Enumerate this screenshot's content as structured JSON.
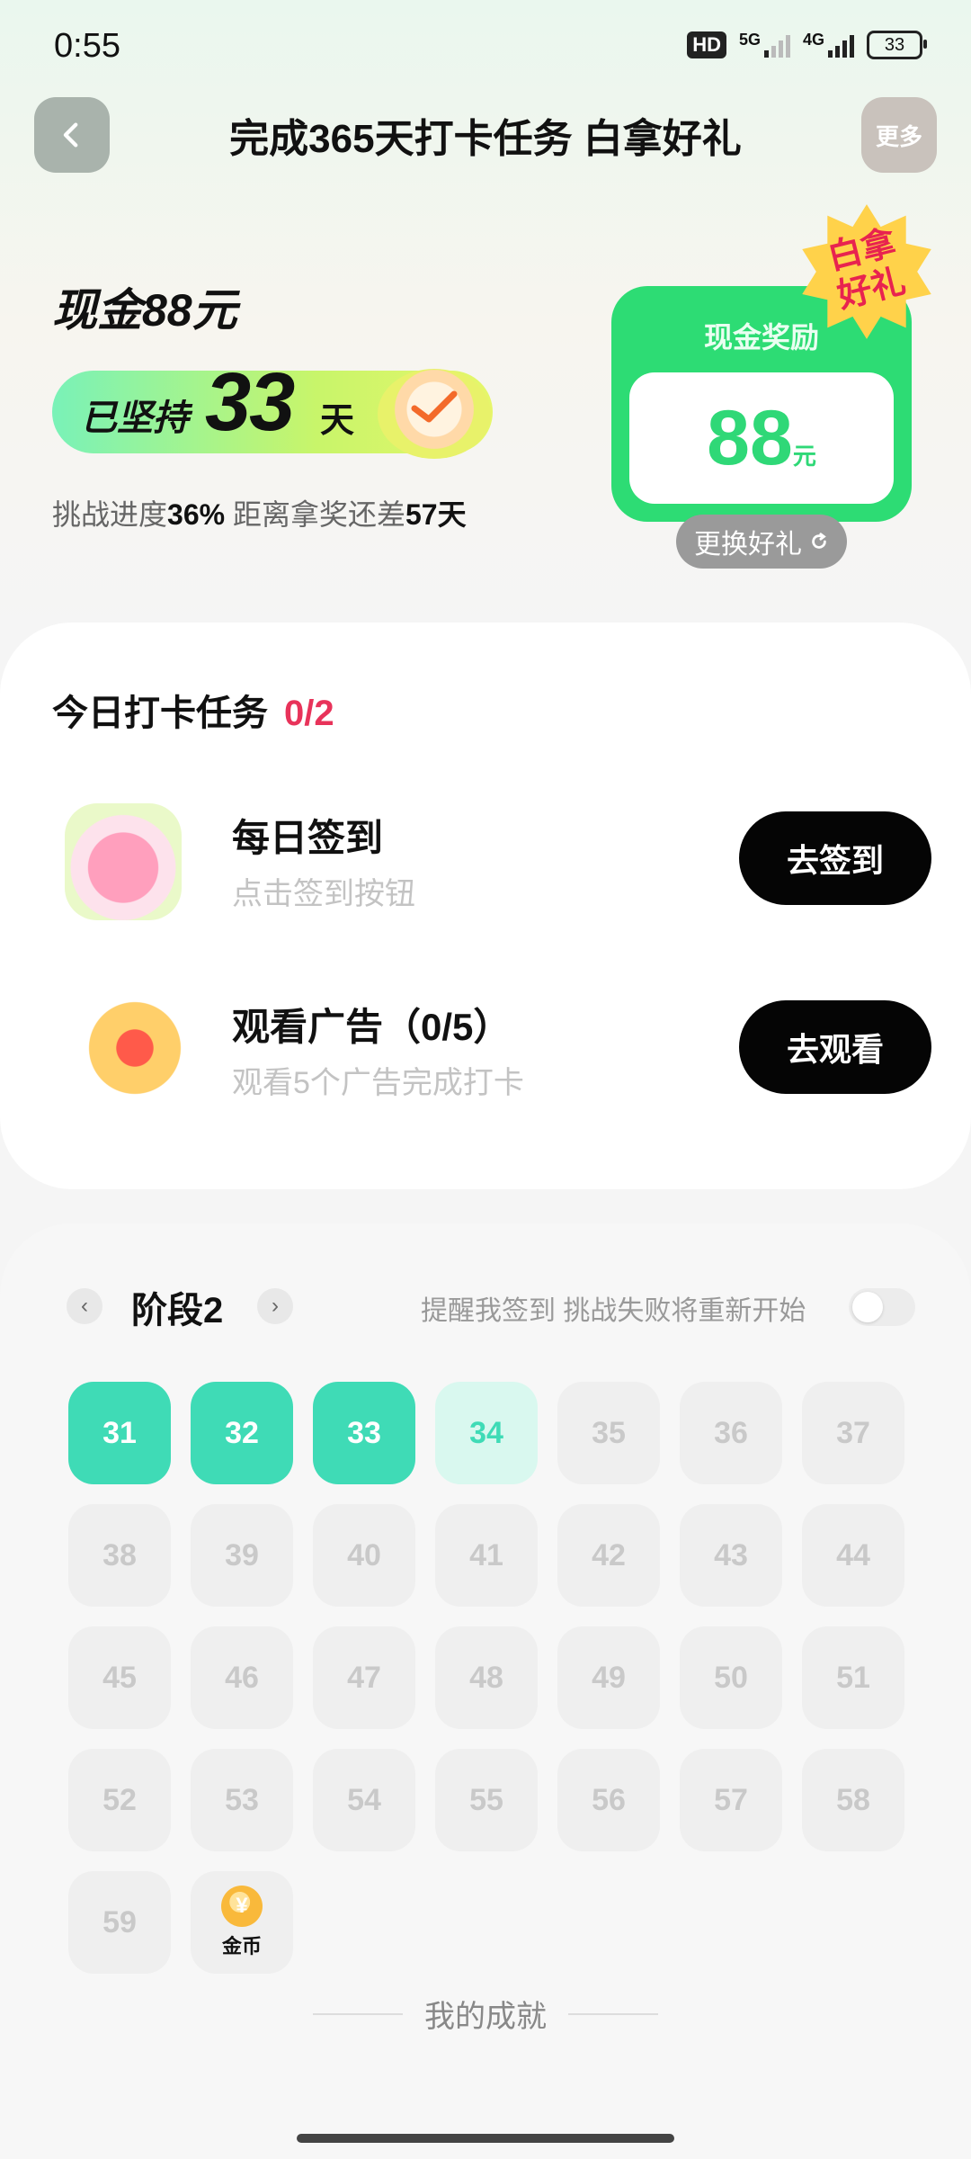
{
  "status_bar": {
    "time": "0:55",
    "hd": "HD",
    "net1": "5G",
    "net2": "4G",
    "battery": "33"
  },
  "header": {
    "title": "完成365天打卡任务 白拿好礼",
    "more_label": "更多"
  },
  "hero": {
    "cash_title": "现金88元",
    "persist_label": "已坚持",
    "persist_days": "33",
    "persist_unit": "天",
    "progress_prefix": "挑战进度",
    "progress_pct": "36%",
    "remaining_prefix": "距离拿奖还差",
    "remaining_days": "57天"
  },
  "reward": {
    "label": "现金奖励",
    "amount": "88",
    "unit": "元",
    "badge_line1": "白拿",
    "badge_line2": "好礼",
    "change_label": "更换好礼"
  },
  "tasks": {
    "header": "今日打卡任务",
    "count": "0/2",
    "items": [
      {
        "title": "每日签到",
        "subtitle": "点击签到按钮",
        "button": "去签到",
        "icon": "calendar-heart-icon"
      },
      {
        "title": "观看广告（0/5）",
        "subtitle": "观看5个广告完成打卡",
        "button": "去观看",
        "icon": "gift-box-icon"
      }
    ]
  },
  "stage": {
    "title": "阶段2",
    "remind_text": "提醒我签到 挑战失败将重新开始",
    "remind_on": false,
    "days": [
      {
        "label": "31",
        "state": "done"
      },
      {
        "label": "32",
        "state": "done"
      },
      {
        "label": "33",
        "state": "done"
      },
      {
        "label": "34",
        "state": "current"
      },
      {
        "label": "35",
        "state": "locked"
      },
      {
        "label": "36",
        "state": "locked"
      },
      {
        "label": "37",
        "state": "locked"
      },
      {
        "label": "38",
        "state": "locked"
      },
      {
        "label": "39",
        "state": "locked"
      },
      {
        "label": "40",
        "state": "locked"
      },
      {
        "label": "41",
        "state": "locked"
      },
      {
        "label": "42",
        "state": "locked"
      },
      {
        "label": "43",
        "state": "locked"
      },
      {
        "label": "44",
        "state": "locked"
      },
      {
        "label": "45",
        "state": "locked"
      },
      {
        "label": "46",
        "state": "locked"
      },
      {
        "label": "47",
        "state": "locked"
      },
      {
        "label": "48",
        "state": "locked"
      },
      {
        "label": "49",
        "state": "locked"
      },
      {
        "label": "50",
        "state": "locked"
      },
      {
        "label": "51",
        "state": "locked"
      },
      {
        "label": "52",
        "state": "locked"
      },
      {
        "label": "53",
        "state": "locked"
      },
      {
        "label": "54",
        "state": "locked"
      },
      {
        "label": "55",
        "state": "locked"
      },
      {
        "label": "56",
        "state": "locked"
      },
      {
        "label": "57",
        "state": "locked"
      },
      {
        "label": "58",
        "state": "locked"
      },
      {
        "label": "59",
        "state": "locked"
      }
    ],
    "coin_symbol": "¥",
    "coin_label": "金币"
  },
  "achievements": {
    "label": "我的成就"
  },
  "colors": {
    "accent_green": "#2ddc74",
    "day_done": "#3fdbb6",
    "count_red": "#e8335a"
  }
}
